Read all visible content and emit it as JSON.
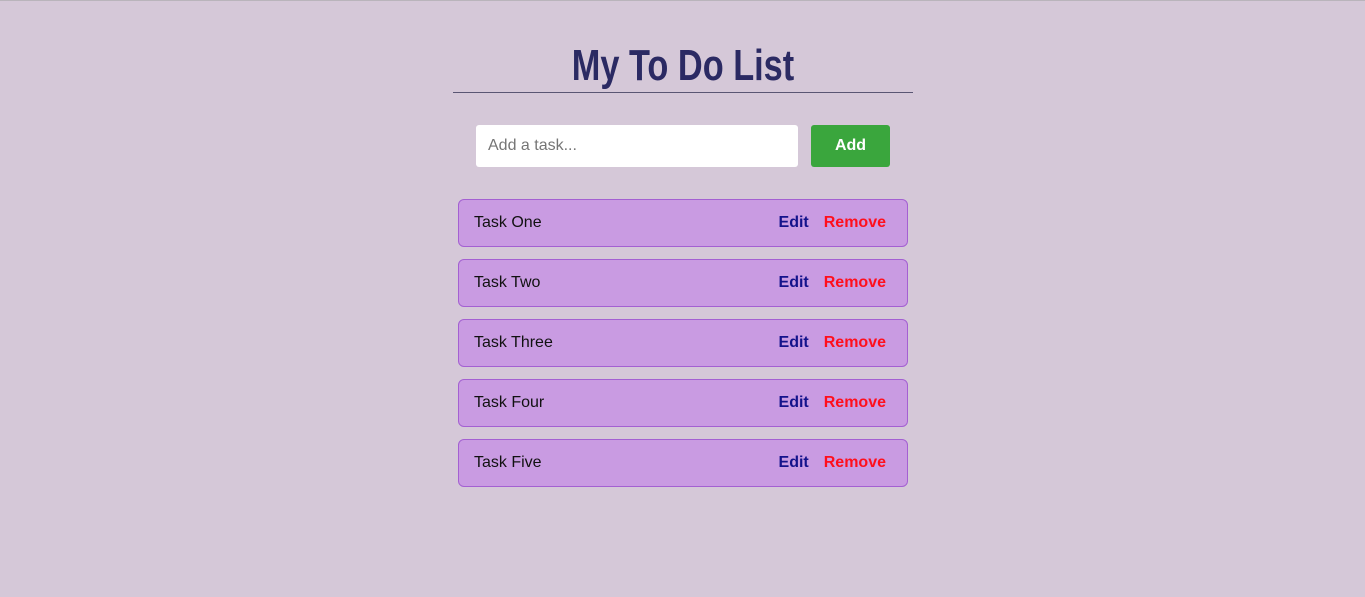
{
  "header": {
    "title": "My To Do List"
  },
  "add_form": {
    "placeholder": "Add a task...",
    "value": "",
    "add_label": "Add"
  },
  "tasks": [
    {
      "text": "Task One",
      "edit_label": "Edit",
      "remove_label": "Remove"
    },
    {
      "text": "Task Two",
      "edit_label": "Edit",
      "remove_label": "Remove"
    },
    {
      "text": "Task Three",
      "edit_label": "Edit",
      "remove_label": "Remove"
    },
    {
      "text": "Task Four",
      "edit_label": "Edit",
      "remove_label": "Remove"
    },
    {
      "text": "Task Five",
      "edit_label": "Edit",
      "remove_label": "Remove"
    }
  ],
  "colors": {
    "background": "#d5c8d8",
    "title": "#2b2a63",
    "add_button": "#3aa63d",
    "task_bg": "#c99be2",
    "task_border": "#a460d2",
    "edit": "#14128b",
    "remove": "#ff0f1c"
  }
}
